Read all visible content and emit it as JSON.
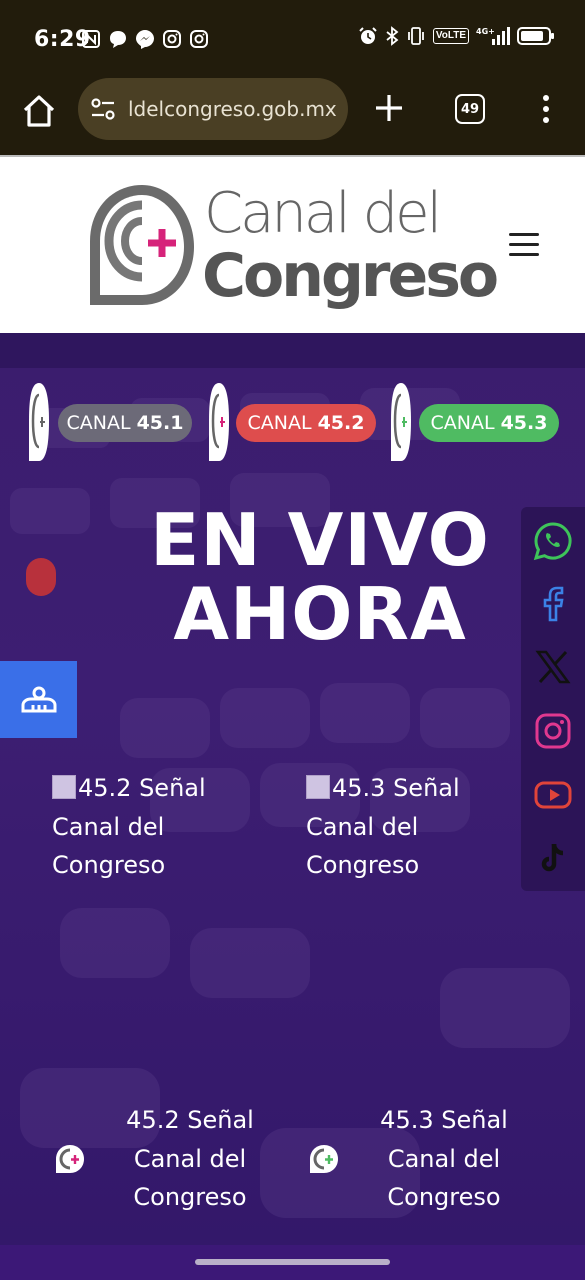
{
  "status_bar": {
    "time": "6:29",
    "notifications": [
      "nfc-icon",
      "messages-icon",
      "messenger-icon",
      "instagram-icon",
      "instagram-icon"
    ],
    "system": [
      "alarm-icon",
      "bluetooth-icon",
      "vibrate-icon",
      "volte-badge",
      "signal-4g-icon",
      "battery-icon"
    ],
    "volte_label": "VoLTE",
    "network_label": "4G+"
  },
  "browser": {
    "url": "ldelcongreso.gob.mx",
    "tab_count": "49"
  },
  "site": {
    "logo_line1": "Canal del",
    "logo_line2": "Congreso",
    "brand_colors": {
      "magenta": "#d6237a",
      "gray": "#666666"
    }
  },
  "hero": {
    "channels": [
      {
        "label": "CANAL",
        "number": "45.1",
        "color": "#6c6a78"
      },
      {
        "label": "CANAL",
        "number": "45.2",
        "color": "#de4d4d"
      },
      {
        "label": "CANAL",
        "number": "45.3",
        "color": "#4fbb62"
      }
    ],
    "title_line1": "EN VIVO",
    "title_line2": "AHORA",
    "signal_images": [
      {
        "alt_line1": "45.2 Señal",
        "alt_line2": "Canal del",
        "alt_line3": "Congreso"
      },
      {
        "alt_line1": "45.3 Señal",
        "alt_line2": "Canal del",
        "alt_line3": "Congreso"
      }
    ],
    "signal_links": [
      {
        "line1": "45.2 Señal",
        "line2": "Canal del",
        "line3": "Congreso"
      },
      {
        "line1": "45.3 Señal",
        "line2": "Canal del",
        "line3": "Congreso"
      }
    ]
  },
  "social": [
    "whatsapp-icon",
    "facebook-icon",
    "x-icon",
    "instagram-icon",
    "youtube-icon",
    "tiktok-icon"
  ]
}
